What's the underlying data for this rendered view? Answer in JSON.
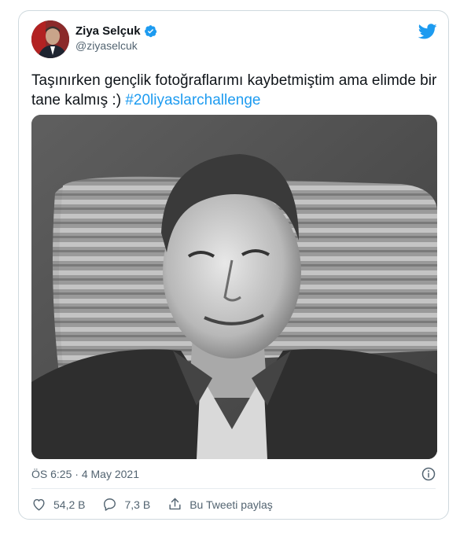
{
  "author": {
    "display_name": "Ziya Selçuk",
    "handle": "@ziyaselcuk"
  },
  "tweet": {
    "text_before": "Taşınırken gençlik fotoğraflarımı kaybetmiştim ama elimde bir tane kalmış :) ",
    "hashtag": "#20liyaslarchallenge",
    "time": "ÖS 6:25",
    "separator": " · ",
    "date": "4 May 2021"
  },
  "actions": {
    "like_count": "54,2 B",
    "reply_count": "7,3 B",
    "share_label": "Bu Tweeti paylaş"
  },
  "colors": {
    "accent": "#1d9bf0",
    "muted": "#536471",
    "text": "#0f1419"
  },
  "icons": [
    "verified-badge-icon",
    "twitter-bird-icon",
    "info-icon",
    "heart-icon",
    "reply-icon",
    "share-icon"
  ]
}
